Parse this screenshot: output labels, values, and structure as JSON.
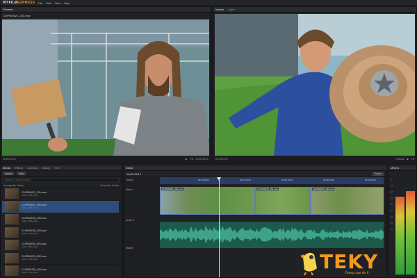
{
  "app": {
    "logo_main": "HITFILM",
    "logo_accent": "EXPRESS",
    "menu": [
      "File",
      "Edit",
      "View",
      "Help"
    ]
  },
  "left_viewer": {
    "tabs": [
      "Trimmer"
    ],
    "clip_name": "CLIP000021_201.mov",
    "timecode_left": "00:00:00:00",
    "timecode_right": "00:00:00:00",
    "zoom": "Fit"
  },
  "right_viewer": {
    "tabs": [
      "Viewer",
      "Layer"
    ],
    "timecode_left": "00:00:15:17",
    "zoom": "Fit",
    "options": "Options"
  },
  "media": {
    "tabs": [
      "Media",
      "Effects",
      "Controls",
      "History",
      "Text"
    ],
    "import_label": "Import",
    "new_label": "New",
    "search_placeholder": "Search in Project Media",
    "arrange_label": "Arrange By: Name",
    "group_label": "Group By: Folder",
    "items": [
      {
        "name": "CLIP000021_201.mov",
        "meta": "1920 x 1080 pixels"
      },
      {
        "name": "CLIP000021_301.mov",
        "meta": "1920 x 1080 pixels"
      },
      {
        "name": "CLIP000078_100.mov",
        "meta": "1920 x 1080 pixels"
      },
      {
        "name": "CLIP000078_200.mov",
        "meta": "1920 x 1080 pixels"
      },
      {
        "name": "CLIP000078_301.mov",
        "meta": "1920 x 1080 pixels"
      },
      {
        "name": "CLIP000078_302.mov",
        "meta": "1920 x 1080 pixels"
      },
      {
        "name": "CLIP000780_100.mov",
        "meta": "1920 x 1080 pixels"
      }
    ],
    "selected_index": 1
  },
  "editor": {
    "tab": "Editor",
    "timecode": "00:00:15:17",
    "export_label": "Export",
    "tracks_label": "Tracks",
    "video_track": "Video 1",
    "audio_track": "Audio 1",
    "master_label": "Master",
    "ruler_marks": [
      "00:00:05:00",
      "00:00:10:00",
      "00:00:15:00",
      "00:00:20:00",
      "00:00:25:00"
    ],
    "clips": [
      "CLIP000021_201.mov",
      "CLIP000078_201.mov",
      "CLIP000078_100.mov"
    ]
  },
  "meters": {
    "tab": "Meters",
    "scale": [
      "-6",
      "-12",
      "-18",
      "-24",
      "-30",
      "-36",
      "-42",
      "-48",
      "-54"
    ],
    "levels": [
      0.78,
      0.84
    ]
  },
  "watermark": {
    "text": "TEKY",
    "sub": "Young can do it"
  },
  "colors": {
    "accent": "#f08a1c",
    "selection": "#2f4d7a",
    "audio": "#1c5a4c",
    "video_track": "#203352"
  }
}
